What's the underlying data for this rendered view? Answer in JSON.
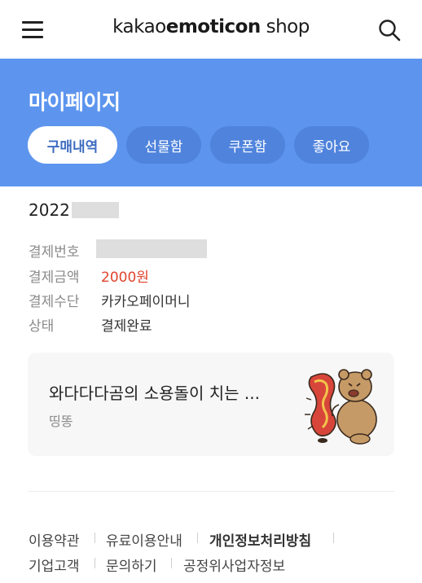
{
  "header": {
    "logo_prefix": "kakao",
    "logo_bold": "emoticon",
    "logo_suffix": " shop"
  },
  "banner": {
    "title": "마이페이지",
    "tabs": [
      {
        "label": "구매내역",
        "active": true
      },
      {
        "label": "선물함",
        "active": false
      },
      {
        "label": "쿠폰함",
        "active": false
      },
      {
        "label": "좋아요",
        "active": false
      }
    ]
  },
  "purchase": {
    "date": "2022.",
    "rows": [
      {
        "label": "결제번호",
        "value": ""
      },
      {
        "label": "결제금액",
        "value": "2000원"
      },
      {
        "label": "결제수단",
        "value": "카카오페이머니"
      },
      {
        "label": "상태",
        "value": "결제완료"
      }
    ]
  },
  "item": {
    "title": "와다다다곰의 소용돌이 치는 ...",
    "author": "띵똥"
  },
  "footer": {
    "links": [
      "이용약관",
      "유료이용안내",
      "개인정보처리방침",
      "기업고객",
      "문의하기",
      "공정위사업자정보"
    ]
  },
  "colors": {
    "banner_bg": "#5d95ee",
    "tab_inactive_bg": "#4f83dc",
    "tab_active_text": "#3d6cc0",
    "price_red": "#e0442d"
  },
  "icons": [
    "menu-icon",
    "search-icon"
  ]
}
